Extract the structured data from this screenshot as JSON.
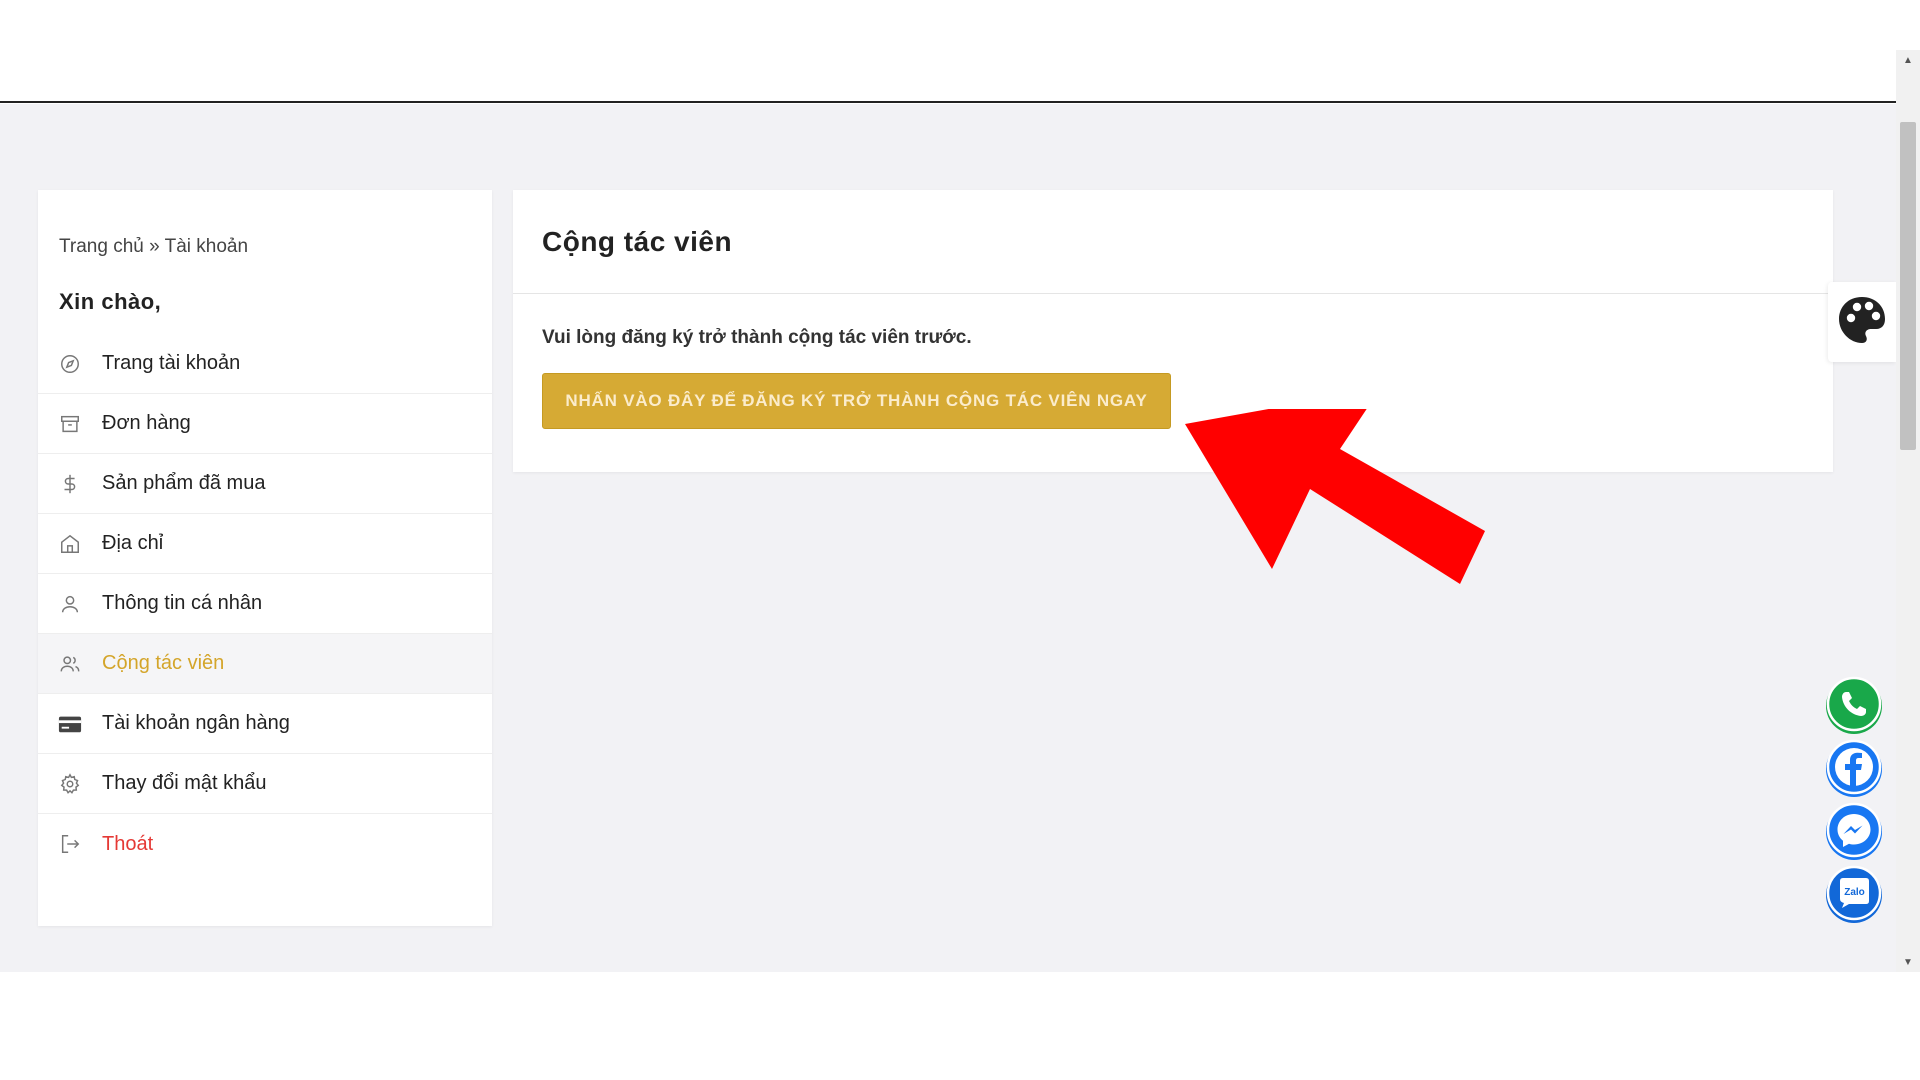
{
  "breadcrumb": "Trang chủ » Tài khoản",
  "greeting": "Xin chào,",
  "sidebar": {
    "items": [
      {
        "label": "Trang tài khoản",
        "icon": "compass-icon"
      },
      {
        "label": "Đơn hàng",
        "icon": "archive-box-icon"
      },
      {
        "label": "Sản phẩm đã mua",
        "icon": "dollar-icon"
      },
      {
        "label": "Địa chỉ",
        "icon": "home-icon"
      },
      {
        "label": "Thông tin cá nhân",
        "icon": "user-icon"
      },
      {
        "label": "Cộng tác viên",
        "icon": "users-icon",
        "active": true
      },
      {
        "label": "Tài khoản ngân hàng",
        "icon": "credit-card-icon"
      },
      {
        "label": "Thay đổi mật khẩu",
        "icon": "gear-icon"
      },
      {
        "label": "Thoát",
        "icon": "logout-icon"
      }
    ]
  },
  "main": {
    "title": "Cộng tác viên",
    "notice": "Vui lòng đăng ký trở thành cộng tác viên trước.",
    "cta_label": "NHẤN VÀO ĐÂY ĐỂ ĐĂNG KÝ TRỞ THÀNH CỘNG TÁC VIÊN NGAY"
  },
  "widgets": {
    "palette_icon": "palette-icon",
    "social": [
      "phone-icon",
      "facebook-icon",
      "messenger-icon",
      "zalo-icon"
    ],
    "zalo_text": "Zalo"
  },
  "colors": {
    "accent": "#d6aa34",
    "active_text": "#d4a52a",
    "logout_text": "#e53935",
    "annotation_arrow": "#ff0000"
  }
}
